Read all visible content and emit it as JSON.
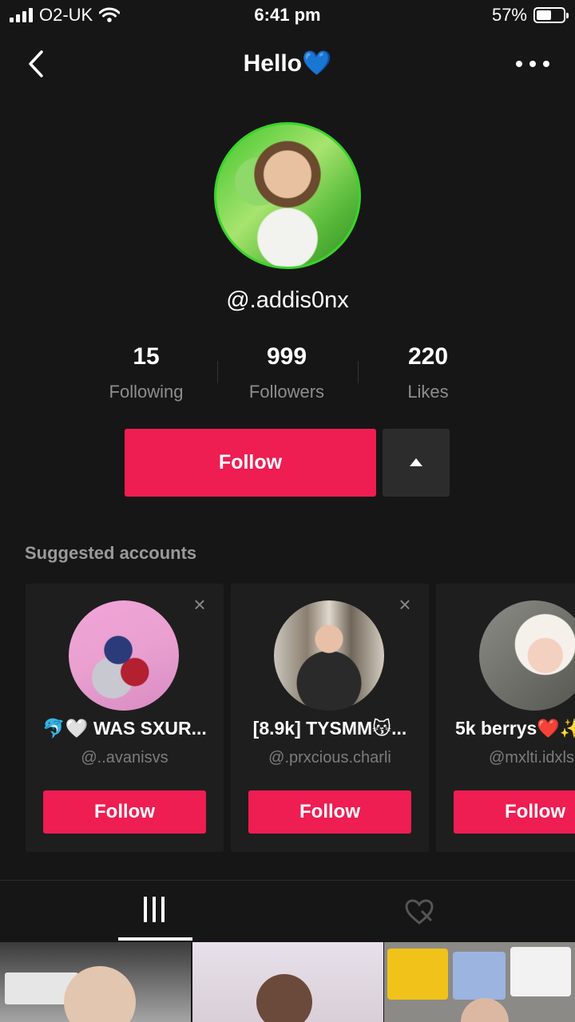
{
  "status_bar": {
    "carrier": "O2-UK",
    "time": "6:41 pm",
    "battery_percent": "57%",
    "battery_level": 0.57
  },
  "header": {
    "title": "Hello💙"
  },
  "profile": {
    "username": "@.addis0nx",
    "stats": [
      {
        "value": "15",
        "label": "Following"
      },
      {
        "value": "999",
        "label": "Followers"
      },
      {
        "value": "220",
        "label": "Likes"
      }
    ],
    "follow_label": "Follow"
  },
  "suggested": {
    "title": "Suggested accounts",
    "accounts": [
      {
        "name": "🐬🤍 WAS SXUR...",
        "handle": "@..avanisvs",
        "follow_label": "Follow",
        "close": "×"
      },
      {
        "name": "[8.9k] TYSMM😽...",
        "handle": "@.prxcious.charli",
        "follow_label": "Follow",
        "close": "×"
      },
      {
        "name": "5k berrys❤️✨",
        "handle": "@mxlti.idxls",
        "follow_label": "Follow"
      }
    ]
  },
  "tabs": {
    "active": "videos",
    "items": [
      "videos-grid-icon",
      "liked-heart-icon"
    ]
  },
  "colors": {
    "accent": "#ee1d52",
    "background": "#161616"
  }
}
